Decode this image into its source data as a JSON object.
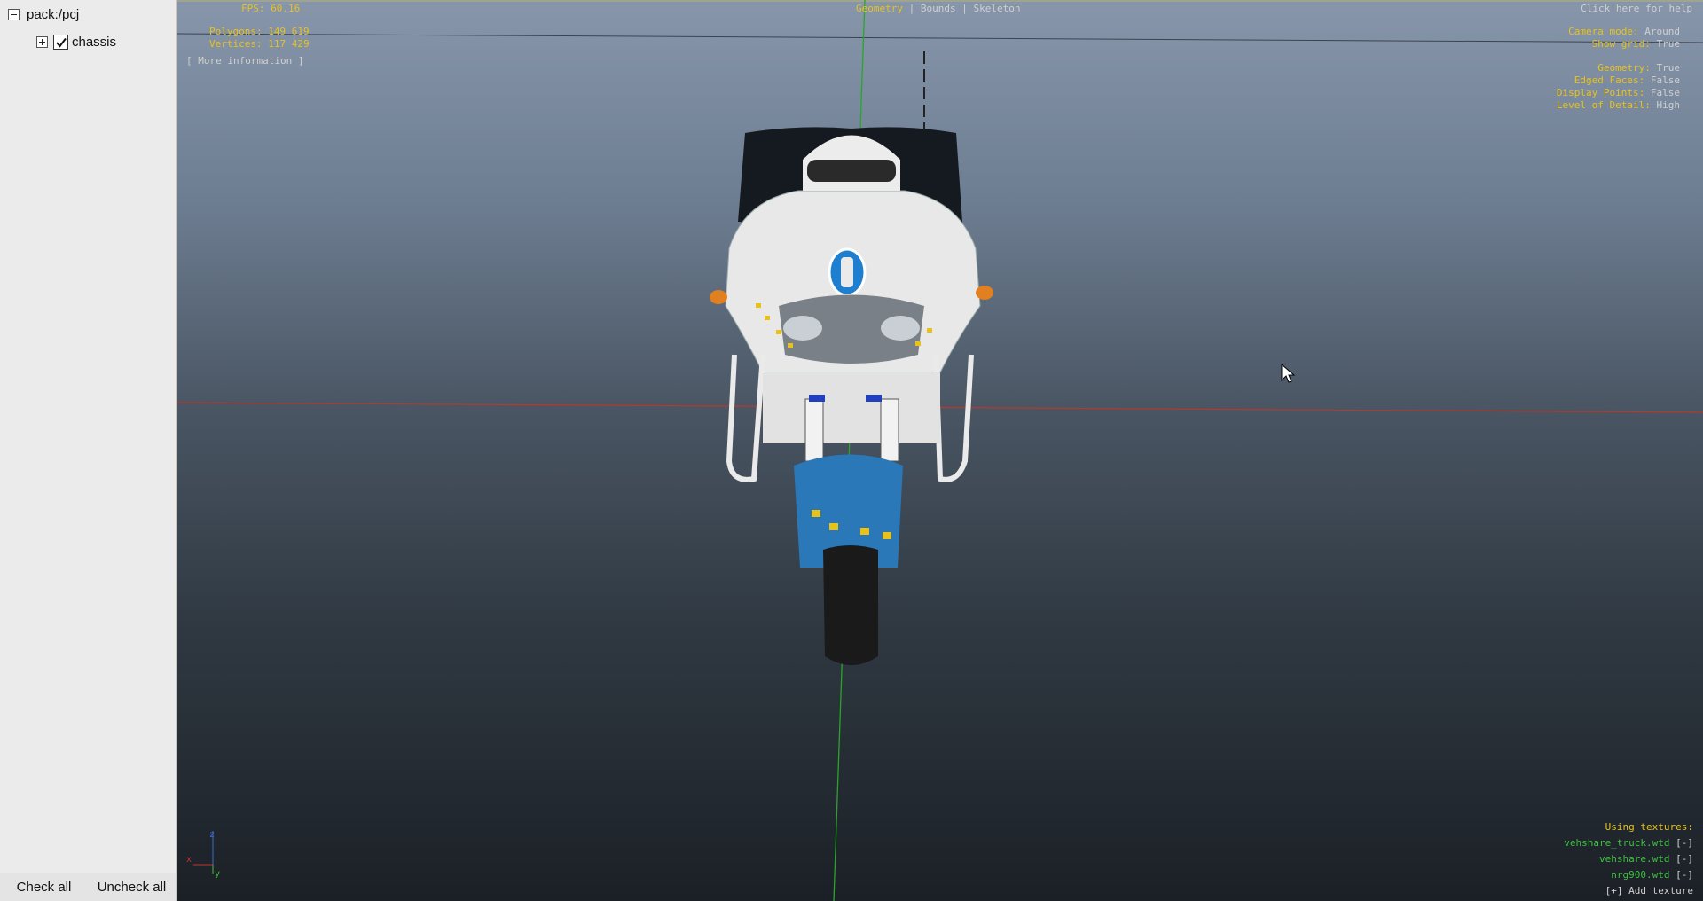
{
  "tree": {
    "root_label": "pack:/pcj",
    "child_label": "chassis"
  },
  "buttons": {
    "check_all": "Check all",
    "uncheck_all": "Uncheck all"
  },
  "stats": {
    "fps": "FPS: 60.16",
    "polygons": "Polygons: 149 619",
    "vertices": "Vertices: 117 429",
    "more_info": "[ More information ]"
  },
  "view_tabs": {
    "geometry": "Geometry",
    "bounds": "Bounds",
    "skeleton": "Skeleton",
    "separator": "|"
  },
  "help_link": "Click here for help",
  "settings": {
    "camera_mode_key": "Camera mode:",
    "camera_mode_val": "Around",
    "show_grid_key": "Show grid:",
    "show_grid_val": "True",
    "geometry_key": "Geometry:",
    "geometry_val": "True",
    "edged_faces_key": "Edged Faces:",
    "edged_faces_val": "False",
    "display_points_key": "Display Points:",
    "display_points_val": "False",
    "lod_key": "Level of Detail:",
    "lod_val": "High"
  },
  "textures": {
    "heading": "Using textures:",
    "items": [
      {
        "name": "vehshare_truck.wtd",
        "remove": "[-]"
      },
      {
        "name": "vehshare.wtd",
        "remove": "[-]"
      },
      {
        "name": "nrg900.wtd",
        "remove": "[-]"
      }
    ],
    "add": "[+] Add texture"
  },
  "axes": {
    "x": "x",
    "y": "y",
    "z": "z"
  },
  "colors": {
    "accent_yellow": "#e8c21a",
    "texture_green": "#3ec23e",
    "panel_bg": "#ebebeb"
  }
}
